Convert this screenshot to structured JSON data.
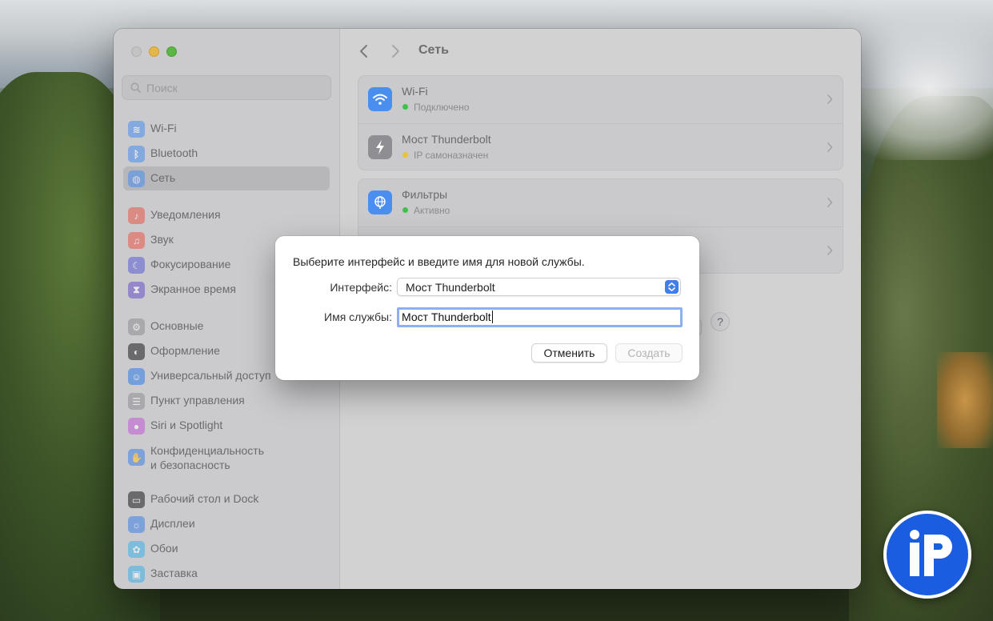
{
  "window": {
    "title": "Сеть"
  },
  "search": {
    "placeholder": "Поиск"
  },
  "sidebar": {
    "items": [
      {
        "label": "Wi-Fi",
        "icon": "wifi-icon",
        "color": "#4a8ef0"
      },
      {
        "label": "Bluetooth",
        "icon": "bluetooth-icon",
        "color": "#4a8ef0"
      },
      {
        "label": "Сеть",
        "icon": "globe-icon",
        "color": "#4a8ef0",
        "active": true
      },
      {
        "label": "Уведомления",
        "icon": "bell-icon",
        "color": "#e8574a"
      },
      {
        "label": "Звук",
        "icon": "speaker-icon",
        "color": "#e8574a"
      },
      {
        "label": "Фокусирование",
        "icon": "moon-icon",
        "color": "#5b5bd6"
      },
      {
        "label": "Экранное время",
        "icon": "hourglass-icon",
        "color": "#6a52c9"
      },
      {
        "label": "Основные",
        "icon": "gear-icon",
        "color": "#8e8e93"
      },
      {
        "label": "Оформление",
        "icon": "appearance-icon",
        "color": "#1c1c1e"
      },
      {
        "label": "Универсальный доступ",
        "icon": "accessibility-icon",
        "color": "#2f7ce8"
      },
      {
        "label": "Пункт управления",
        "icon": "control-center-icon",
        "color": "#8e8e93"
      },
      {
        "label": "Siri и Spotlight",
        "icon": "siri-icon",
        "color": "#c25ad6"
      },
      {
        "label": "Конфиденциальность",
        "label2": "и безопасность",
        "icon": "hand-icon",
        "color": "#3f7fe8"
      },
      {
        "label": "Рабочий стол и Dock",
        "icon": "dock-icon",
        "color": "#1c1c1e"
      },
      {
        "label": "Дисплеи",
        "icon": "sun-icon",
        "color": "#3f7fe8"
      },
      {
        "label": "Обои",
        "icon": "flower-icon",
        "color": "#3fb0e8"
      },
      {
        "label": "Заставка",
        "icon": "screensaver-icon",
        "color": "#3fb0e8"
      }
    ]
  },
  "services": {
    "group1": [
      {
        "title": "Wi-Fi",
        "status": "Подключено",
        "status_color": "#3ec24c",
        "icon": "wifi-icon",
        "icon_color": "#4a8ef0"
      },
      {
        "title": "Мост Thunderbolt",
        "status": "IP самоназначен",
        "status_color": "#e9c23a",
        "icon": "thunderbolt-icon",
        "icon_color": "#8e8e93"
      }
    ],
    "group2": [
      {
        "title": "Фильтры",
        "status": "Активно",
        "status_color": "#3ec24c",
        "icon": "globe-icon",
        "icon_color": "#4a8ef0"
      }
    ]
  },
  "toolbar": {
    "more_label": "··· ⌄",
    "help_label": "?"
  },
  "dialog": {
    "message": "Выберите интерфейс и введите имя для новой службы.",
    "interface_label": "Интерфейс:",
    "interface_value": "Мост Thunderbolt",
    "name_label": "Имя службы:",
    "name_value": "Мост Thunderbolt",
    "cancel_label": "Отменить",
    "create_label": "Создать"
  }
}
